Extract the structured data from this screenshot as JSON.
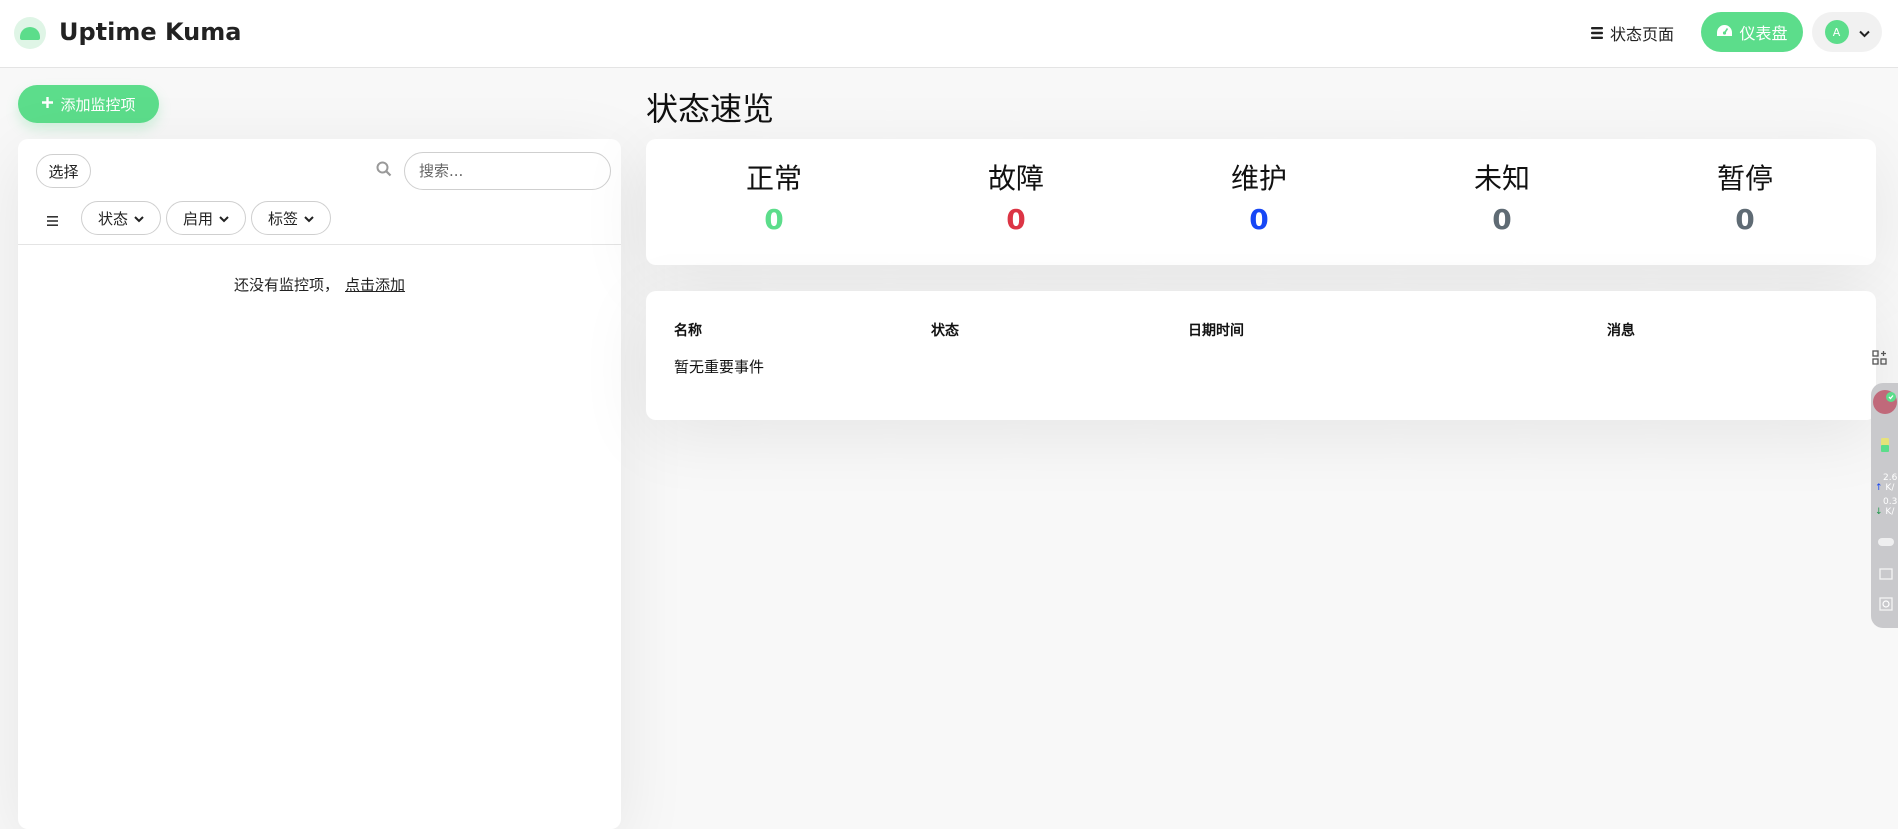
{
  "header": {
    "app_title": "Uptime Kuma",
    "status_page_label": "状态页面",
    "dashboard_label": "仪表盘",
    "avatar_initial": "A"
  },
  "sidebar": {
    "add_monitor_label": "添加监控项",
    "select_label": "选择",
    "search_placeholder": "搜索...",
    "filters": [
      "状态",
      "启用",
      "标签"
    ],
    "empty_text": "还没有监控项，",
    "empty_link": "点击添加"
  },
  "main": {
    "title": "状态速览",
    "stats": [
      {
        "label": "正常",
        "value": "0",
        "color": "#5cdd8b"
      },
      {
        "label": "故障",
        "value": "0",
        "color": "#dc3545"
      },
      {
        "label": "维护",
        "value": "0",
        "color": "#1747f5"
      },
      {
        "label": "未知",
        "value": "0",
        "color": "#5f6b74"
      },
      {
        "label": "暂停",
        "value": "0",
        "color": "#5f6b74"
      }
    ],
    "events_table": {
      "columns": [
        "名称",
        "状态",
        "日期时间",
        "消息"
      ],
      "empty_text": "暂无重要事件"
    }
  },
  "side_widget": {
    "upload_value": "2.6",
    "upload_unit": "K/",
    "download_value": "0.3",
    "download_unit": "K/"
  },
  "colors": {
    "accent": "#5cdd8b",
    "background": "#f8f8f8"
  }
}
